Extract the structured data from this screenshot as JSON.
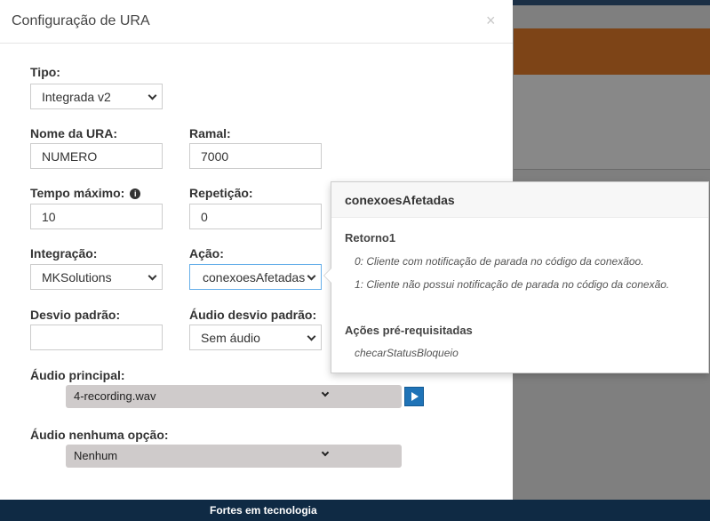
{
  "modal": {
    "title": "Configuração de URA",
    "close": "×"
  },
  "form": {
    "tipo": {
      "label": "Tipo:",
      "value": "Integrada v2"
    },
    "nome_ura": {
      "label": "Nome da URA:",
      "value": "NUMERO"
    },
    "ramal": {
      "label": "Ramal:",
      "value": "7000"
    },
    "tempo_maximo": {
      "label": "Tempo máximo:",
      "info_icon": "info-icon",
      "value": "10"
    },
    "repeticao": {
      "label": "Repetição:",
      "value": "0"
    },
    "integracao": {
      "label": "Integração:",
      "value": "MKSolutions"
    },
    "acao": {
      "label": "Ação:",
      "value": "conexoesAfetadas"
    },
    "desvio_padrao": {
      "label": "Desvio padrão:",
      "value": ""
    },
    "audio_desvio_padrao": {
      "label": "Áudio desvio padrão:",
      "value": "Sem áudio"
    },
    "audio_principal": {
      "label": "Áudio principal:",
      "value": "4-recording.wav",
      "play_icon": "play-icon"
    },
    "audio_nenhuma_opcao": {
      "label": "Áudio nenhuma opção:",
      "value": "Nenhum"
    }
  },
  "popover": {
    "title": "conexoesAfetadas",
    "retorno_heading": "Retorno1",
    "retorno_items": [
      "0: Cliente com notificação de parada no código da conexãoo.",
      "1: Cliente não possui notificação de parada no código da conexão."
    ],
    "prereq_heading": "Ações pré-requisitadas",
    "prereq_items": [
      "checarStatusBloqueio"
    ]
  },
  "footer": {
    "text": "Fortes em tecnologia"
  },
  "colors": {
    "topbar": "#1b2f45",
    "orange_banner": "#7d4417",
    "footer": "#0f2a44",
    "play_button": "#1f73b7",
    "focus_border": "#66afe9"
  }
}
